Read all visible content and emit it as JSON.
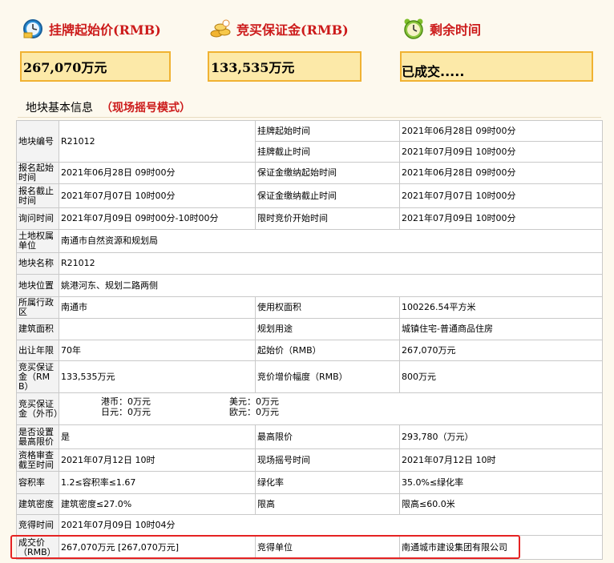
{
  "header": {
    "start_price_label": "挂牌起始价(RMB)",
    "start_price_value": "267,070万元",
    "deposit_label": "竞买保证金(RMB)",
    "deposit_value": "133,535万元",
    "time_label": "剩余时间",
    "time_value": "已成交.....",
    "icons": [
      "clock-icon",
      "coins-icon",
      "alarm-clock-icon"
    ],
    "colors": {
      "label_red": "#cc1a1a",
      "box_fill": "#fce9a8",
      "box_border": "#f0b232",
      "highlight": "#e52323"
    }
  },
  "section": {
    "title": "地块基本信息",
    "mode": "（现场摇号模式）"
  },
  "table": {
    "r1": {
      "k1": "地块编号",
      "v1": "R21012",
      "k2a": "挂牌起始时间",
      "v2a": "2021年06月28日 09时00分",
      "k2b": "挂牌截止时间",
      "v2b": "2021年07月09日 10时00分"
    },
    "r2": {
      "k1": "报名起始时间",
      "v1": "2021年06月28日 09时00分",
      "k2": "保证金缴纳起始时间",
      "v2": "2021年06月28日 09时00分"
    },
    "r3": {
      "k1": "报名截止时间",
      "v1": "2021年07月07日 10时00分",
      "k2": "保证金缴纳截止时间",
      "v2": "2021年07月07日 10时00分"
    },
    "r4": {
      "k1": "询问时间",
      "v1": "2021年07月09日 09时00分-10时00分",
      "k2": "限时竞价开始时间",
      "v2": "2021年07月09日 10时00分"
    },
    "r5": {
      "k1": "土地权属单位",
      "v1": "南通市自然资源和规划局"
    },
    "r6": {
      "k1": "地块名称",
      "v1": "R21012"
    },
    "r7": {
      "k1": "地块位置",
      "v1": "姚港河东、规划二路两侧"
    },
    "r8": {
      "k1": "所属行政区",
      "v1": "南通市",
      "k2": "使用权面积",
      "v2": "100226.54平方米"
    },
    "r9": {
      "k1": "建筑面积",
      "v1": "",
      "k2": "规划用途",
      "v2": "城镇住宅-普通商品住房"
    },
    "r10": {
      "k1": "出让年限",
      "v1": "70年",
      "k2": "起始价（RMB）",
      "v2": "267,070万元"
    },
    "r11": {
      "k1": "竞买保证金（RMB）",
      "v1": "133,535万元",
      "k2": "竞价增价幅度（RMB）",
      "v2": "800万元"
    },
    "r12": {
      "k1": "竞买保证金（外币）",
      "hkd": "港币：0万元",
      "jpy": "日元：0万元",
      "usd": "美元：0万元",
      "eur": "欧元：0万元"
    },
    "r13": {
      "k1": "是否设置最高限价",
      "v1": "是",
      "k2": "最高限价",
      "v2": "293,780（万元）"
    },
    "r14": {
      "k1": "资格审查截至时间",
      "v1": "2021年07月12日 10时",
      "k2": "现场摇号时间",
      "v2": "2021年07月12日 10时"
    },
    "r15": {
      "k1": "容积率",
      "v1": "1.2≤容积率≤1.67",
      "k2": "绿化率",
      "v2": "35.0%≤绿化率"
    },
    "r16": {
      "k1": "建筑密度",
      "v1": "建筑密度≤27.0%",
      "k2": "限高",
      "v2": "限高≤60.0米"
    },
    "r17": {
      "k1": "竞得时间",
      "v1": "2021年07月09日 10时04分"
    },
    "r18": {
      "k1": "成交价（RMB）",
      "v1": "267,070万元 [267,070万元]",
      "k2": "竞得单位",
      "v2": "南通城市建设集团有限公司"
    }
  }
}
